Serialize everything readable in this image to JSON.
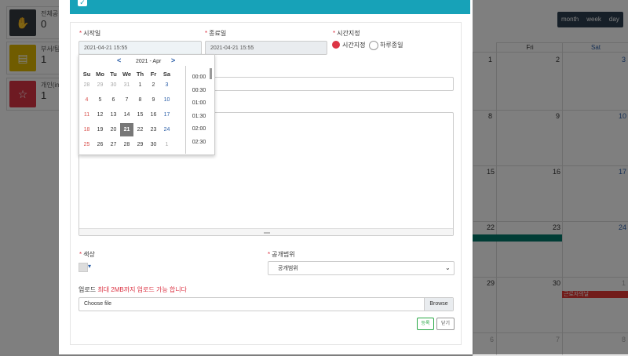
{
  "stat_cards": [
    {
      "label": "전체공",
      "count": "0",
      "color": "#343a40",
      "icon": "handshake-icon"
    },
    {
      "label": "부서/팀",
      "count": "1",
      "color": "#e0b800",
      "icon": "presentation-icon"
    },
    {
      "label": "개인(in",
      "count": "1",
      "color": "#dc3545",
      "icon": "star-icon"
    }
  ],
  "calendar": {
    "view_buttons": [
      "month",
      "week",
      "day"
    ],
    "headers": [
      "Fri",
      "Sat"
    ],
    "day_numbers": {
      "row1": [
        "1",
        "2",
        "3"
      ],
      "row2": [
        "8",
        "9",
        "10"
      ],
      "row3": [
        "15",
        "16",
        "17"
      ],
      "row4": [
        "22",
        "23",
        "24"
      ],
      "row5": [
        "29",
        "30",
        "1"
      ],
      "row6": [
        "6",
        "7",
        "8"
      ]
    },
    "event_label": "근로자의날",
    "teal_color": "#00796b",
    "event_color": "#e53935"
  },
  "modal": {
    "header_color": "#17a2b8",
    "start": {
      "label": "시작일",
      "value": "2021-04-21 15:55"
    },
    "end": {
      "label": "종료일",
      "value": "2021-04-21 15:55"
    },
    "time_mode": {
      "label": "시간지정",
      "options": [
        "시간지정",
        "하루종일"
      ],
      "selected_color": "#dc3545"
    },
    "color_label": "색상",
    "scope": {
      "label": "공개범위",
      "value": "공개범위"
    },
    "upload": {
      "label": "업로드",
      "hint": "최대 2MB까지 업로드 가능 합니다",
      "placeholder": "Choose file",
      "browse": "Browse"
    },
    "buttons": {
      "register": "등록",
      "close": "닫기"
    }
  },
  "datepicker": {
    "month_label": "2021 - Apr",
    "prev": "<",
    "next": ">",
    "dow": [
      "Su",
      "Mo",
      "Tu",
      "We",
      "Th",
      "Fr",
      "Sa"
    ],
    "weeks": [
      [
        "28",
        "29",
        "30",
        "31",
        "1",
        "2",
        "3"
      ],
      [
        "4",
        "5",
        "6",
        "7",
        "8",
        "9",
        "10"
      ],
      [
        "11",
        "12",
        "13",
        "14",
        "15",
        "16",
        "17"
      ],
      [
        "18",
        "19",
        "20",
        "21",
        "22",
        "23",
        "24"
      ],
      [
        "25",
        "26",
        "27",
        "28",
        "29",
        "30",
        "1"
      ]
    ],
    "out_of_month": [
      [
        0,
        0
      ],
      [
        0,
        1
      ],
      [
        0,
        2
      ],
      [
        0,
        3
      ],
      [
        4,
        6
      ]
    ],
    "selected_day": "21",
    "times": [
      "00:00",
      "00:30",
      "01:00",
      "01:30",
      "02:00",
      "02:30"
    ]
  }
}
